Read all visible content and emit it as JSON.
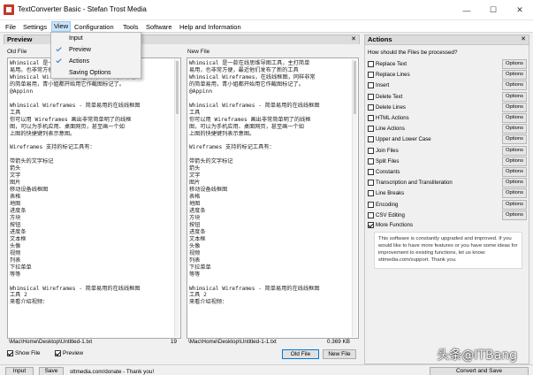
{
  "window": {
    "title": "TextConverter Basic - Stefan Trost Media",
    "minimize": "—",
    "maximize": "☐",
    "close": "✕"
  },
  "menu": [
    "File",
    "Settings",
    "View",
    "Configuration",
    "Tools",
    "Software",
    "Help and Information"
  ],
  "view_menu": {
    "items": [
      "Input",
      "Preview",
      "Actions",
      "Saving Options"
    ]
  },
  "preview": {
    "title": "Preview",
    "old_file_label": "Old File",
    "new_file_label": "New File",
    "old_text": "Whimsical 是一款在线思维导图工具，主打简单\n易用。也非常方便，最近他们发布了新的工具\nWhimsical Wireframes，在线线框图，同样非常\n的简单易用，青小姐都开始用它作截图标记了。\n@Appinn\n\nWhimsical Wireframes - 简单易用的在线线框图\n工具\n你可以用 Wireframes 画出非常简单明了的线框\n图，可以为手机应用、桌面网页，甚至画一个如\n上图的快捷键列表示意图。\n\nWireframes 支持的标记工具有：\n\n带箭头的文字标记\n箭头\n文字\n图片\n移动设备线框图\n表格\n地图\n进度条\n方块\n按钮\n进度条\n文本框\n头像\n视频\n列表\n下拉菜单\n等等\n\nWhimsical Wireframes - 简单易用的在线线框图\n工具 2\n来看介绍视频：",
    "new_text": "Whimsical 是一款在线思维导图工具，主打简单\n易用，也非常方便，最近他们发布了新的工具\nWhimsical Wireframes，在线线框图，同样非常\n的简单易用，青小姐都开始用它作截图标记了。\n@Appinn\n\nWhimsical Wireframes - 简单易用的在线线框图\n工具\n你可以用 Wireframes 画出非常简单明了的线框\n图，可以为手机应用、桌面网页，甚至画一个如\n上图的快捷键列表示意图。\n\nWireframes 支持的标记工具有：\n\n带箭头的文字标记\n箭头\n文字\n图片\n移动设备线框图\n表格\n地图\n进度条\n方块\n按钮\n进度条\n文本框\n头像\n视频\n列表\n下拉菜单\n等等\n\nWhimsical Wireframes - 简单易用的在线线框图\n工具 2\n来看介绍视频：",
    "old_path": "\\Mac\\Home\\Desktop\\Untitled-1.txt",
    "old_count": "19",
    "new_path": "\\Mac\\Home\\Desktop\\Untitled-1-1.txt",
    "new_size": "0.369 KB",
    "show_file": "Show File",
    "preview_cb": "Preview",
    "old_file_btn": "Old File",
    "new_file_btn": "New File"
  },
  "actions": {
    "title": "Actions",
    "question": "How should the Files be processed?",
    "options_label": "Options",
    "items": [
      {
        "label": "Replace Text",
        "checked": false
      },
      {
        "label": "Replace Lines",
        "checked": false
      },
      {
        "label": "Insert",
        "checked": false
      },
      {
        "label": "Delete Text",
        "checked": false
      },
      {
        "label": "Delete Lines",
        "checked": false
      },
      {
        "label": "HTML Actions",
        "checked": false
      },
      {
        "label": "Line Actions",
        "checked": false
      },
      {
        "label": "Upper and Lower Case",
        "checked": false
      },
      {
        "label": "Join Files",
        "checked": false
      },
      {
        "label": "Split Files",
        "checked": false
      },
      {
        "label": "Constants",
        "checked": false
      },
      {
        "label": "Transcription and Transliteration",
        "checked": false
      },
      {
        "label": "Line Breaks",
        "checked": false
      },
      {
        "label": "Encoding",
        "checked": false
      },
      {
        "label": "CSV Editing",
        "checked": false
      }
    ],
    "more_functions": "More Functions",
    "info": "This software is constantly upgraded and improved. If you would like to have more features or you have some ideas for improvement to existing functions, let us know: sttmedia.com/support. Thank you."
  },
  "status": {
    "input": "Input",
    "save": "Save",
    "donate": "sttmedia.com/donate - Thank you!",
    "convert": "Convert and Save"
  },
  "watermark": "头条@ITBang"
}
